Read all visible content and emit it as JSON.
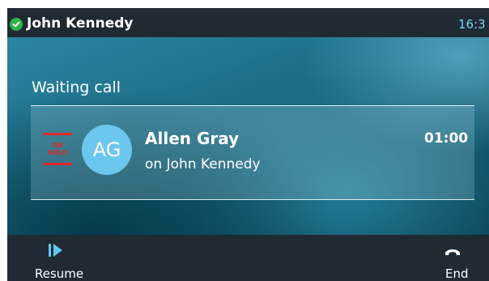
{
  "status_bar": {
    "account_name": "John Kennedy",
    "time": "16:3",
    "status_icon": "check-circle-icon",
    "status_color": "#2fb34a"
  },
  "section_title": "Waiting call",
  "call": {
    "hold_label_line1": "ON",
    "hold_label_line2": "HOLD",
    "avatar_initials": "AG",
    "caller_name": "Allen Gray",
    "line_text": "on John Kennedy",
    "duration": "01:00",
    "hold_color": "#e02a2a",
    "avatar_color": "#6cc7ee"
  },
  "softkeys": {
    "resume": {
      "label": "Resume",
      "icon": "resume-icon"
    },
    "end": {
      "label": "End",
      "icon": "hang-up-phone-icon"
    }
  }
}
